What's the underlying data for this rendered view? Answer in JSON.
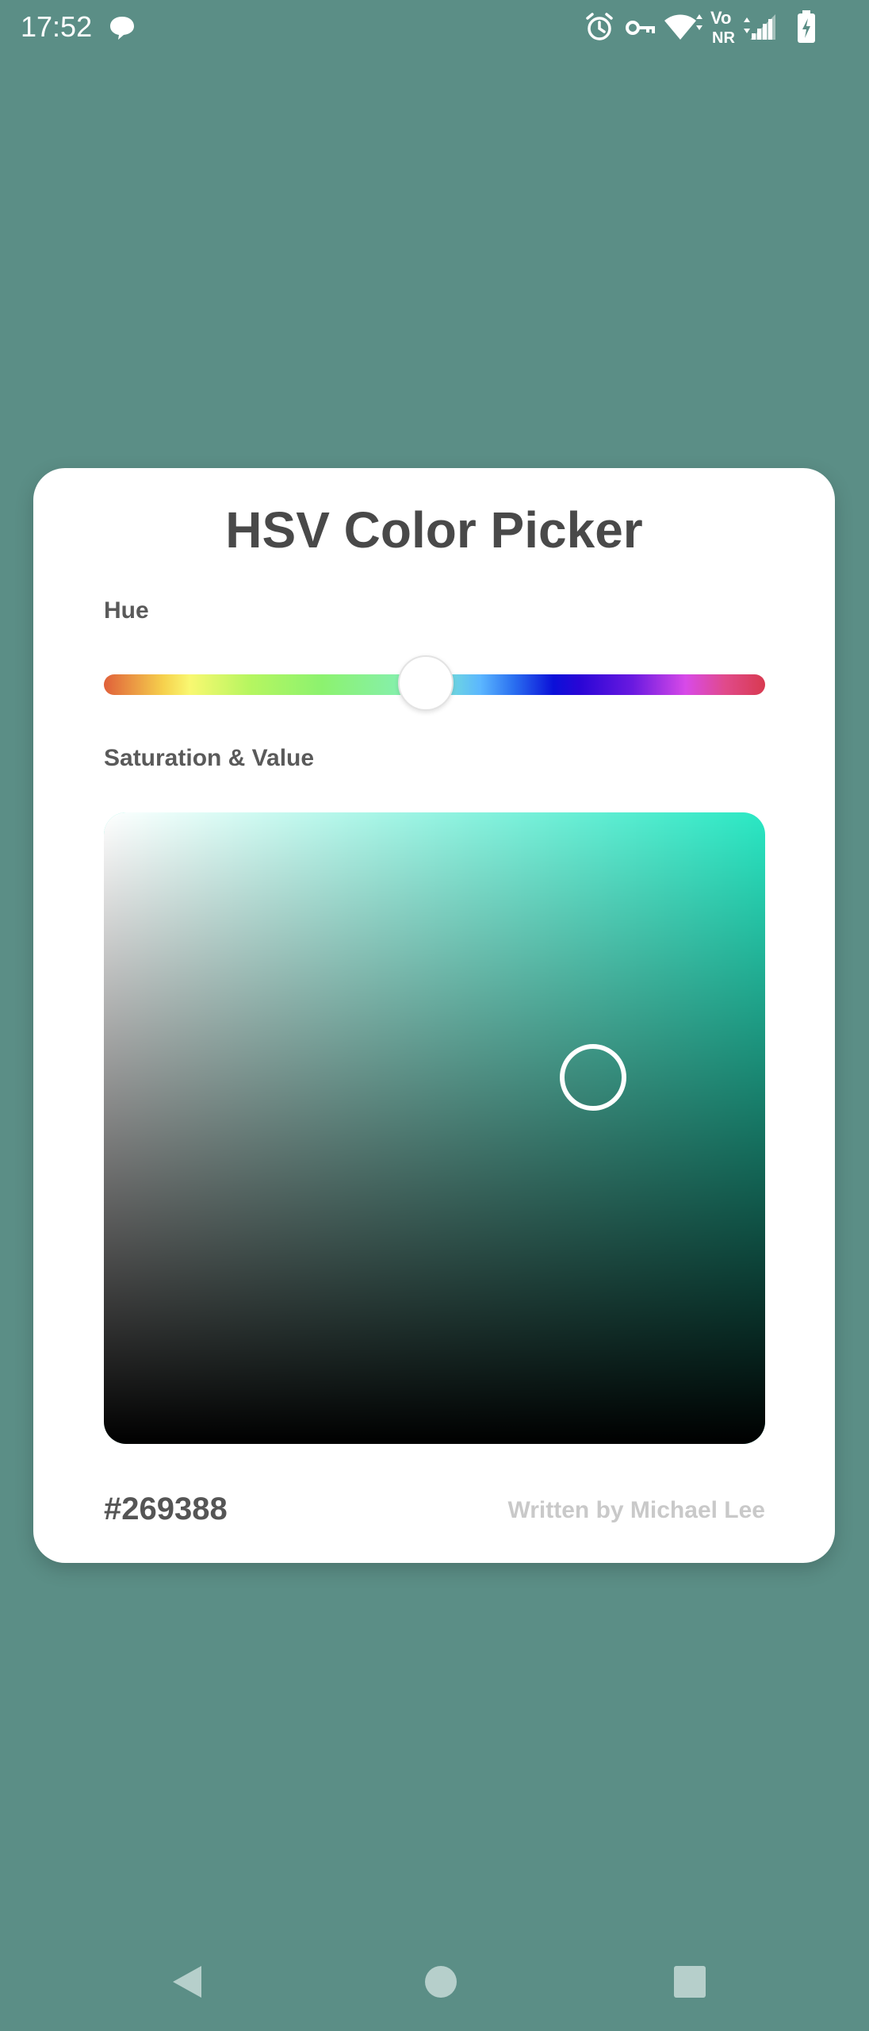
{
  "theme": {
    "background": "#5b8e86",
    "card": "#ffffff",
    "title_color": "#494949",
    "credit_color": "#c9c9c9",
    "nav_icon_color": "#b6cfcb"
  },
  "status_bar": {
    "time": "17:52",
    "icons": [
      "chat-bubble-icon",
      "alarm-icon",
      "vpn-key-icon",
      "wifi-icon",
      "volte-nr-icon",
      "signal-icon",
      "battery-charging-icon"
    ],
    "volte_label_top": "Vo",
    "volte_label_bottom": "NR"
  },
  "card": {
    "title": "HSV Color Picker",
    "hue_label": "Hue",
    "sv_label": "Saturation & Value",
    "hex_value": "#269388",
    "credit": "Written by Michael Lee"
  },
  "picker": {
    "hue_fraction": 0.487,
    "saturation": 0.74,
    "value": 0.58,
    "hue_color": "#2ae8c4"
  },
  "nav_bar": {
    "buttons": [
      "back-icon",
      "home-icon",
      "recents-icon"
    ]
  }
}
